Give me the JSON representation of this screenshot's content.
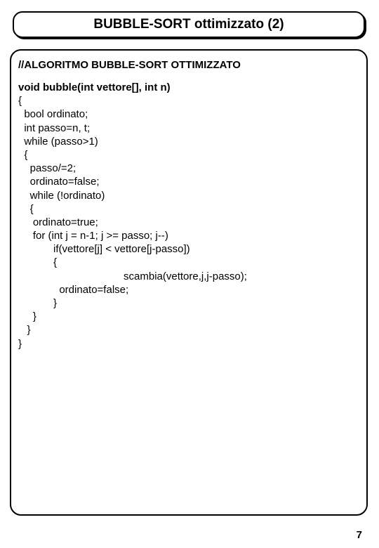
{
  "title": "BUBBLE-SORT ottimizzato (2)",
  "comment": "//ALGORITMO BUBBLE-SORT OTTIMIZZATO",
  "code": {
    "l1": "void bubble(int vettore[], int n)",
    "l2": "{",
    "l3": "  bool ordinato;",
    "l4": "  int passo=n, t;",
    "l5": "  while (passo>1)",
    "l6": "  {",
    "l7": "    passo/=2;",
    "l8": "    ordinato=false;",
    "l9": "    while (!ordinato)",
    "l10": "    {",
    "l11": "     ordinato=true;",
    "l12": "     for (int j = n-1; j >= passo; j--)",
    "l13": "            if(vettore[j] < vettore[j-passo])",
    "l14": "            {",
    "l15": "                                    scambia(vettore,j,j-passo);",
    "l16": "              ordinato=false;",
    "l17": "            }",
    "l18": "     }",
    "l19": "   }",
    "l20": "}"
  },
  "pageNumber": "7"
}
